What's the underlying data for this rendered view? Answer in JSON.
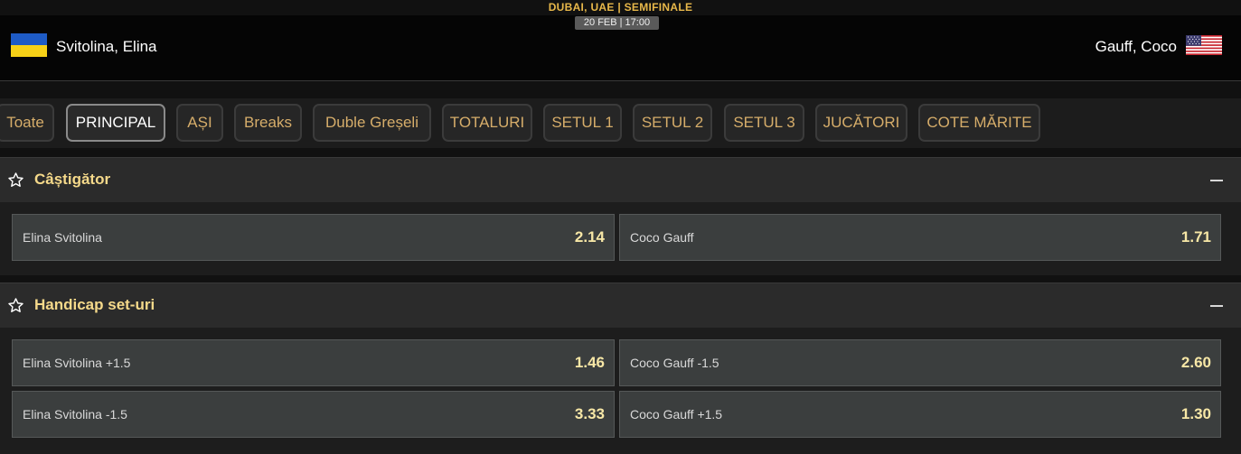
{
  "event": {
    "title": "DUBAI, UAE | SEMIFINALE",
    "date": "20 FEB | 17:00"
  },
  "players": {
    "home": {
      "name": "Svitolina, Elina",
      "flag": "ukraine-flag-icon"
    },
    "away": {
      "name": "Gauff, Coco",
      "flag": "usa-flag-icon"
    }
  },
  "tabs": [
    {
      "label": "Toate"
    },
    {
      "label": "PRINCIPAL",
      "active": true
    },
    {
      "label": "AȘI"
    },
    {
      "label": "Breaks"
    },
    {
      "label": "Duble Greșeli"
    },
    {
      "label": "TOTALURI"
    },
    {
      "label": "SETUL 1"
    },
    {
      "label": "SETUL 2"
    },
    {
      "label": "SETUL 3"
    },
    {
      "label": "JUCĂTORI"
    },
    {
      "label": "COTE MĂRITE"
    }
  ],
  "markets": [
    {
      "title": "Câștigător",
      "rows": [
        [
          {
            "label": "Elina Svitolina",
            "price": "2.14"
          },
          {
            "label": "Coco Gauff",
            "price": "1.71"
          }
        ]
      ]
    },
    {
      "title": "Handicap set-uri",
      "rows": [
        [
          {
            "label": "Elina Svitolina +1.5",
            "price": "1.46"
          },
          {
            "label": "Coco Gauff -1.5",
            "price": "2.60"
          }
        ],
        [
          {
            "label": "Elina Svitolina -1.5",
            "price": "3.33"
          },
          {
            "label": "Coco Gauff +1.5",
            "price": "1.30"
          }
        ]
      ]
    }
  ],
  "colors": {
    "accent": "#e8b84a",
    "tab_text": "#d6ad6a",
    "price": "#f7e7a6",
    "odd_bg": "#3b3e3e"
  }
}
